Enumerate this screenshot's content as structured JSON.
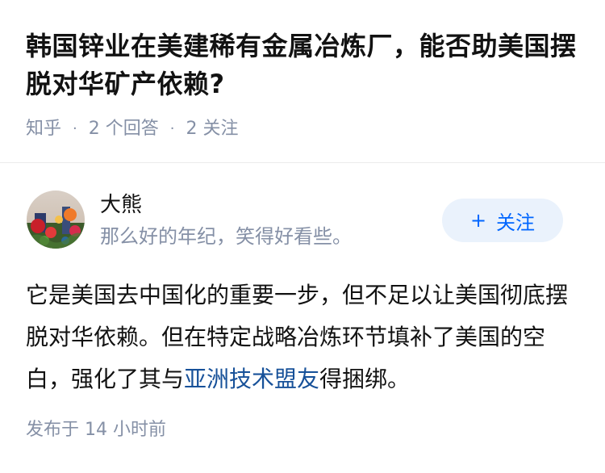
{
  "question": {
    "title": "韩国锌业在美建稀有金属冶炼厂，能否助美国摆脱对华矿产依赖?",
    "source": "知乎",
    "answer_count": "2 个回答",
    "follow_count": "2 关注"
  },
  "author": {
    "name": "大熊",
    "bio": "那么好的年纪，笑得好看些。",
    "follow_label": "关注",
    "follow_icon": "plus-icon"
  },
  "answer": {
    "text_before": "它是美国去中国化的重要一步，但不足以让美国彻底摆脱对华依赖。但在特定战略冶炼环节填补了美国的空白，强化了其与",
    "link_text": "亚洲技术盟友",
    "text_after": "得捆绑。",
    "publish_time": "发布于 14 小时前"
  },
  "colors": {
    "link": "#175199",
    "accent": "#0066ff",
    "meta": "#8590a6",
    "button_bg": "#eaf2fc"
  }
}
